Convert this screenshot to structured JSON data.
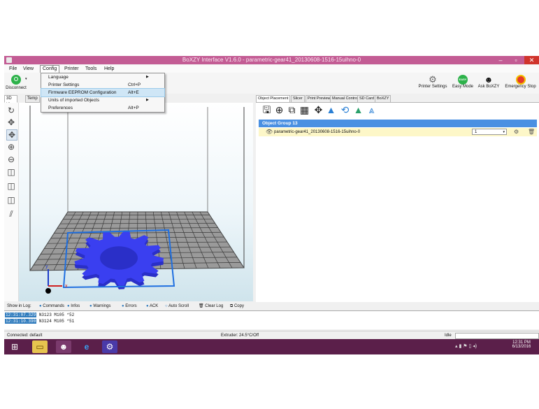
{
  "window": {
    "title": "BoXZY Interface V1.6.0 - parametric-gear41_20130608-1516-15uihno-0",
    "minimize": "–",
    "maximize": "▫",
    "close": "✕"
  },
  "menubar": {
    "items": [
      "File",
      "View",
      "Config",
      "Printer",
      "Tools",
      "Help"
    ],
    "active": "Config"
  },
  "config_menu": {
    "items": [
      {
        "label": "Language",
        "shortcut": "",
        "submenu": true
      },
      {
        "label": "Printer Settings",
        "shortcut": "Ctrl+P",
        "submenu": false
      },
      {
        "label": "Firmware EEPROM Configuration",
        "shortcut": "Alt+E",
        "submenu": false,
        "highlighted": true
      },
      {
        "label": "Units of imported Objects",
        "shortcut": "",
        "submenu": true
      },
      {
        "label": "Preferences",
        "shortcut": "Alt+P",
        "submenu": false
      }
    ]
  },
  "toolbar": {
    "disconnect_label": "Disconnect",
    "printer_settings_label": "Printer Settings",
    "easy_mode_label": "Easy Mode",
    "easy_badge": "EASY",
    "ask_boxzy_label": "Ask BoXZY",
    "emergency_stop_label": "Emergency Stop"
  },
  "left_tabs": [
    "3D View",
    "Temp"
  ],
  "view_tools": [
    "rotate-icon",
    "move-icon",
    "move-object-icon",
    "zoom-in-icon",
    "zoom-out-icon",
    "cube-front-icon",
    "cube-side-icon",
    "cube-top-icon",
    "parallel-view-icon"
  ],
  "viewport": {
    "axis_x_label": "x",
    "axis_y_label": "y",
    "object_color": "#3a3ff0"
  },
  "right_tabs": [
    "Object Placement",
    "Slicer",
    "Print Preview",
    "Manual Control",
    "SD Card",
    "BoXZY"
  ],
  "right_active_tab": "Object Placement",
  "placement_tools": [
    "save-icon",
    "add-icon",
    "copy-icon",
    "autoposition-icon",
    "center-icon",
    "land-icon",
    "rotate-object-icon",
    "scale-icon",
    "cut-icon"
  ],
  "object_group": {
    "title": "Object Group 13",
    "object_name": "parametric-gear41_20130608-1516-15uihno-0",
    "copies": "1"
  },
  "log_toolbar": {
    "show_label": "Show in Log:",
    "commands": "Commands",
    "infos": "Infos",
    "warnings": "Warnings",
    "errors": "Errors",
    "ack": "ACK",
    "auto_scroll": "Auto Scroll",
    "clear_log": "Clear Log",
    "copy": "Copy"
  },
  "log_lines": [
    {
      "time": "12:31:07.329",
      "text": "N3123 M105 *52"
    },
    {
      "time": "12:31:10.390",
      "text": "N3124 M105 *51"
    }
  ],
  "status": {
    "connection": "Connected: default",
    "extruder": "Extruder: 24.5°C/Off",
    "state": "Idle"
  },
  "taskbar": {
    "time": "12:31 PM",
    "date": "6/13/2016"
  },
  "colors": {
    "title_bar": "#c35c94",
    "taskbar": "#5b1f4a",
    "selection_blue": "#4a90e2",
    "easy_green": "#2db24a",
    "stop_red": "#e53a2a"
  }
}
